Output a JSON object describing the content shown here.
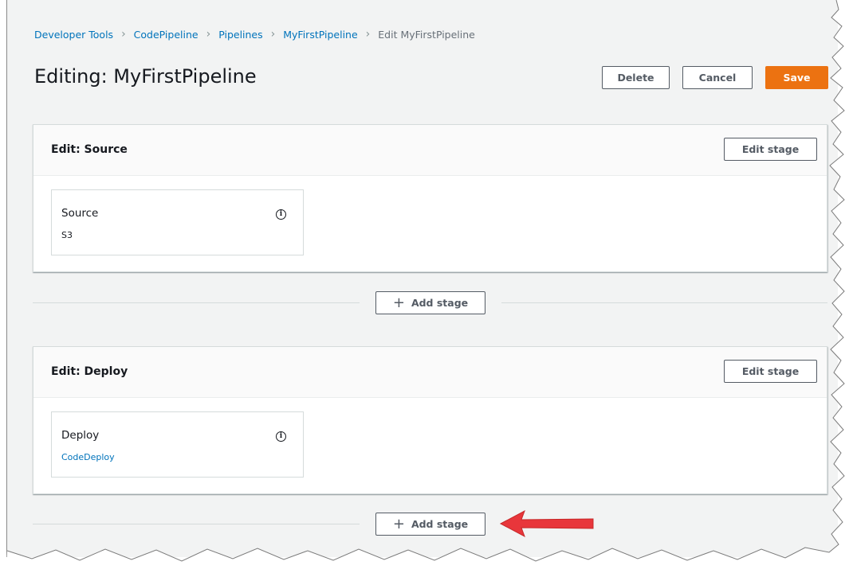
{
  "breadcrumb": {
    "items": [
      "Developer Tools",
      "CodePipeline",
      "Pipelines",
      "MyFirstPipeline"
    ],
    "current": "Edit MyFirstPipeline"
  },
  "header": {
    "title": "Editing: MyFirstPipeline",
    "delete_label": "Delete",
    "cancel_label": "Cancel",
    "save_label": "Save"
  },
  "stages": [
    {
      "title": "Edit: Source",
      "edit_label": "Edit stage",
      "action": {
        "name": "Source",
        "provider": "S3"
      }
    },
    {
      "title": "Edit: Deploy",
      "edit_label": "Edit stage",
      "action": {
        "name": "Deploy",
        "provider": "CodeDeploy"
      }
    }
  ],
  "add_stage_label": "Add stage",
  "icons": {
    "info": "info-icon",
    "plus": "plus-icon",
    "chevron": "chevron-right-icon"
  },
  "colors": {
    "accent": "#ec7211",
    "link": "#0073bb",
    "annotation_arrow": "#e8363b"
  }
}
